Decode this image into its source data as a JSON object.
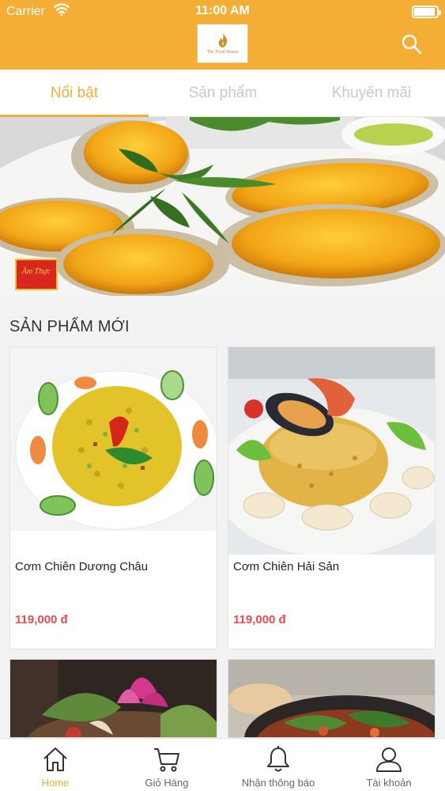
{
  "status_bar": {
    "carrier": "Carrier",
    "time": "11:00 AM"
  },
  "header": {
    "logo_text": "The Food House",
    "search_icon": "search-icon"
  },
  "tabs": [
    {
      "label": "Nổi bật",
      "active": true
    },
    {
      "label": "Sản phẩm",
      "active": false
    },
    {
      "label": "Khuyến mãi",
      "active": false
    }
  ],
  "banner": {
    "badge_text": "Âm Thực"
  },
  "section": {
    "title": "SẢN PHẨM MỚI"
  },
  "products": [
    {
      "name": "Cơm Chiên Dương Châu",
      "price": "119,000 đ"
    },
    {
      "name": "Cơm Chiên Hải Sản",
      "price": "119,000 đ"
    },
    {
      "name": "",
      "price": ""
    },
    {
      "name": "",
      "price": ""
    }
  ],
  "bottom_nav": [
    {
      "label": "Home",
      "icon": "home-icon",
      "active": true
    },
    {
      "label": "Giỏ Hàng",
      "icon": "cart-icon",
      "active": false
    },
    {
      "label": "Nhận thông báo",
      "icon": "bell-icon",
      "active": false
    },
    {
      "label": "Tài khoản",
      "icon": "user-icon",
      "active": false
    }
  ],
  "colors": {
    "accent": "#f5ae35",
    "price": "#e04e4e"
  }
}
